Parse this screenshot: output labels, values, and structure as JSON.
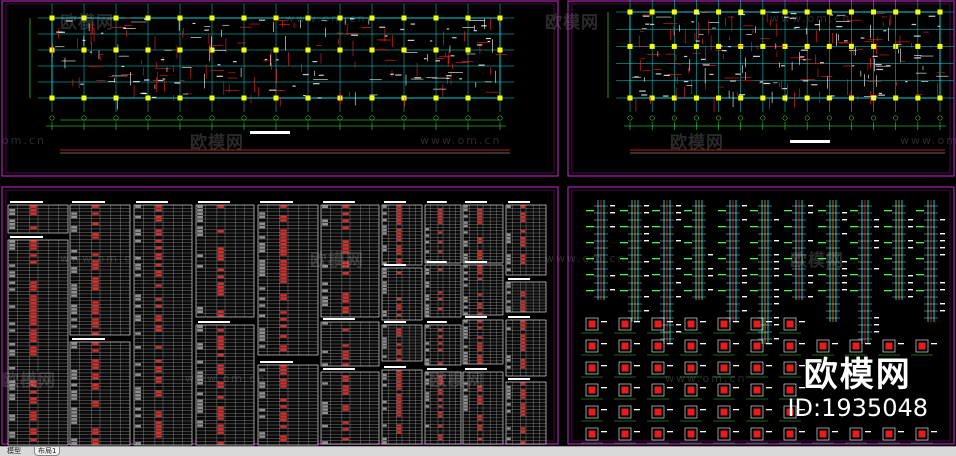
{
  "watermark": {
    "logo_text": "欧模网",
    "url_text": "www.om.cn",
    "short_url": "om.cn",
    "brand": "欧模网",
    "id_label": "ID:1935048"
  },
  "tabs": {
    "model": "模型",
    "layout": "布局1"
  },
  "colors": {
    "background": "#000000",
    "frame": "#b020b0",
    "grid": "#00e0e0",
    "dims": "#3cff3c",
    "columns": "#ffff00",
    "rebar": "#ff2020",
    "text": "#ffffff",
    "table_hot": "#ff3030",
    "bar_orange": "#ff8c00"
  }
}
